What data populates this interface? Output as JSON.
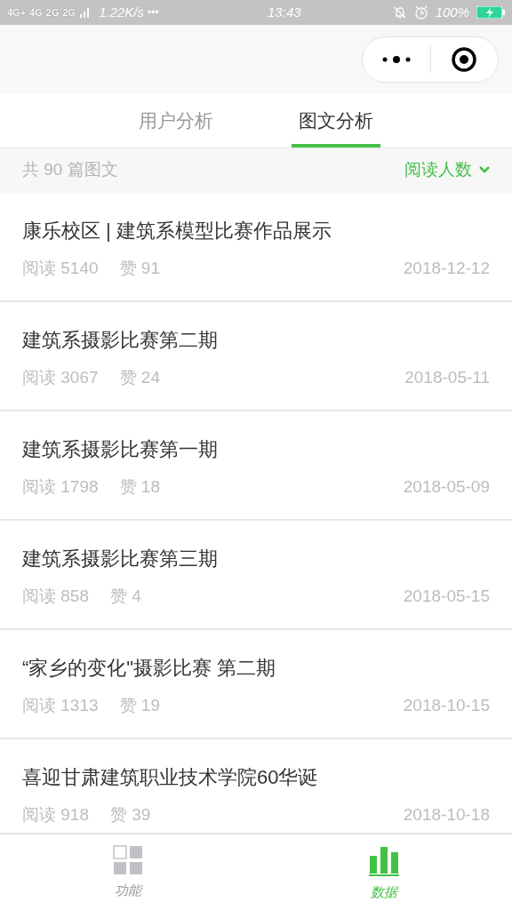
{
  "status_bar": {
    "network_labels": [
      "4G+",
      "4G",
      "2G",
      "2G"
    ],
    "speed": "1.22K/s",
    "more": "•••",
    "time": "13:43",
    "battery": "100%"
  },
  "tabs": [
    {
      "label": "用户分析",
      "selected": false
    },
    {
      "label": "图文分析",
      "selected": true
    }
  ],
  "summary": {
    "count": "共 90 篇图文",
    "sort": "阅读人数"
  },
  "articles": [
    {
      "title": "康乐校区 | 建筑系模型比赛作品展示",
      "reads": "阅读 5140",
      "likes": "赞 91",
      "date": "2018-12-12"
    },
    {
      "title": "建筑系摄影比赛第二期",
      "reads": "阅读 3067",
      "likes": "赞 24",
      "date": "2018-05-11"
    },
    {
      "title": "建筑系摄影比赛第一期",
      "reads": "阅读 1798",
      "likes": "赞 18",
      "date": "2018-05-09"
    },
    {
      "title": "建筑系摄影比赛第三期",
      "reads": "阅读 858",
      "likes": "赞 4",
      "date": "2018-05-15"
    },
    {
      "title": "“家乡的变化\"摄影比赛 第二期",
      "reads": "阅读 1313",
      "likes": "赞 19",
      "date": "2018-10-15"
    },
    {
      "title": "喜迎甘肃建筑职业技术学院60华诞",
      "reads": "阅读 918",
      "likes": "赞 39",
      "date": "2018-10-18"
    }
  ],
  "nav": [
    {
      "kind": "grid",
      "label": "功能",
      "selected": false
    },
    {
      "kind": "chart",
      "label": "数据",
      "selected": true
    }
  ]
}
